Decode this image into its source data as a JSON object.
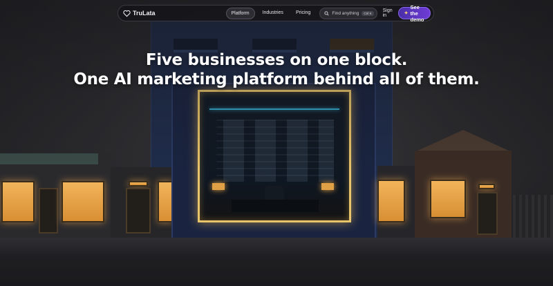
{
  "brand": {
    "name": "TruLata"
  },
  "nav": {
    "links": [
      {
        "label": "Platform",
        "active": true
      },
      {
        "label": "Industries",
        "active": false
      },
      {
        "label": "Pricing",
        "active": false
      }
    ],
    "search": {
      "placeholder": "Find anything",
      "shortcut": "Ctrl K"
    },
    "signin_label": "Sign in",
    "cta_label": "See the demo",
    "cta_icon": "sparkle-icon"
  },
  "hero": {
    "line1": "Five businesses on one block.",
    "line2": "One AI marketing platform behind all of them."
  },
  "colors": {
    "accent": "#6f3cd6",
    "glow": "#e8c46a",
    "night": "#1f2c4a"
  }
}
